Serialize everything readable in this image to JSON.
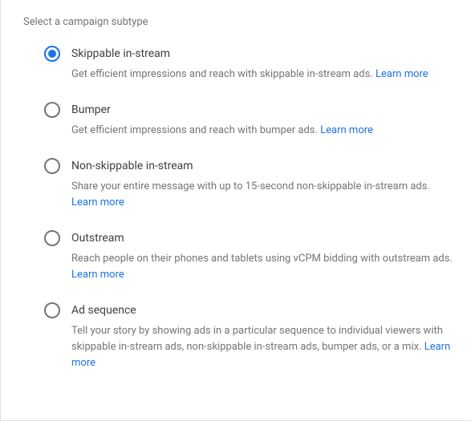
{
  "section_title": "Select a campaign subtype",
  "learn_more_label": "Learn more",
  "options": [
    {
      "title": "Skippable in-stream",
      "description": "Get efficient impressions and reach with skippable in-stream ads. ",
      "selected": true
    },
    {
      "title": "Bumper",
      "description": "Get efficient impressions and reach with bumper ads. ",
      "selected": false
    },
    {
      "title": "Non-skippable in-stream",
      "description": "Share your entire message with up to 15-second non-skippable in-stream ads. ",
      "selected": false
    },
    {
      "title": "Outstream",
      "description": "Reach people on their phones and tablets using vCPM bidding with outstream ads. ",
      "selected": false
    },
    {
      "title": "Ad sequence",
      "description": "Tell your story by showing ads in a particular sequence to individual viewers with skippable in-stream ads, non-skippable in-stream ads, bumper ads, or a mix. ",
      "selected": false
    }
  ]
}
